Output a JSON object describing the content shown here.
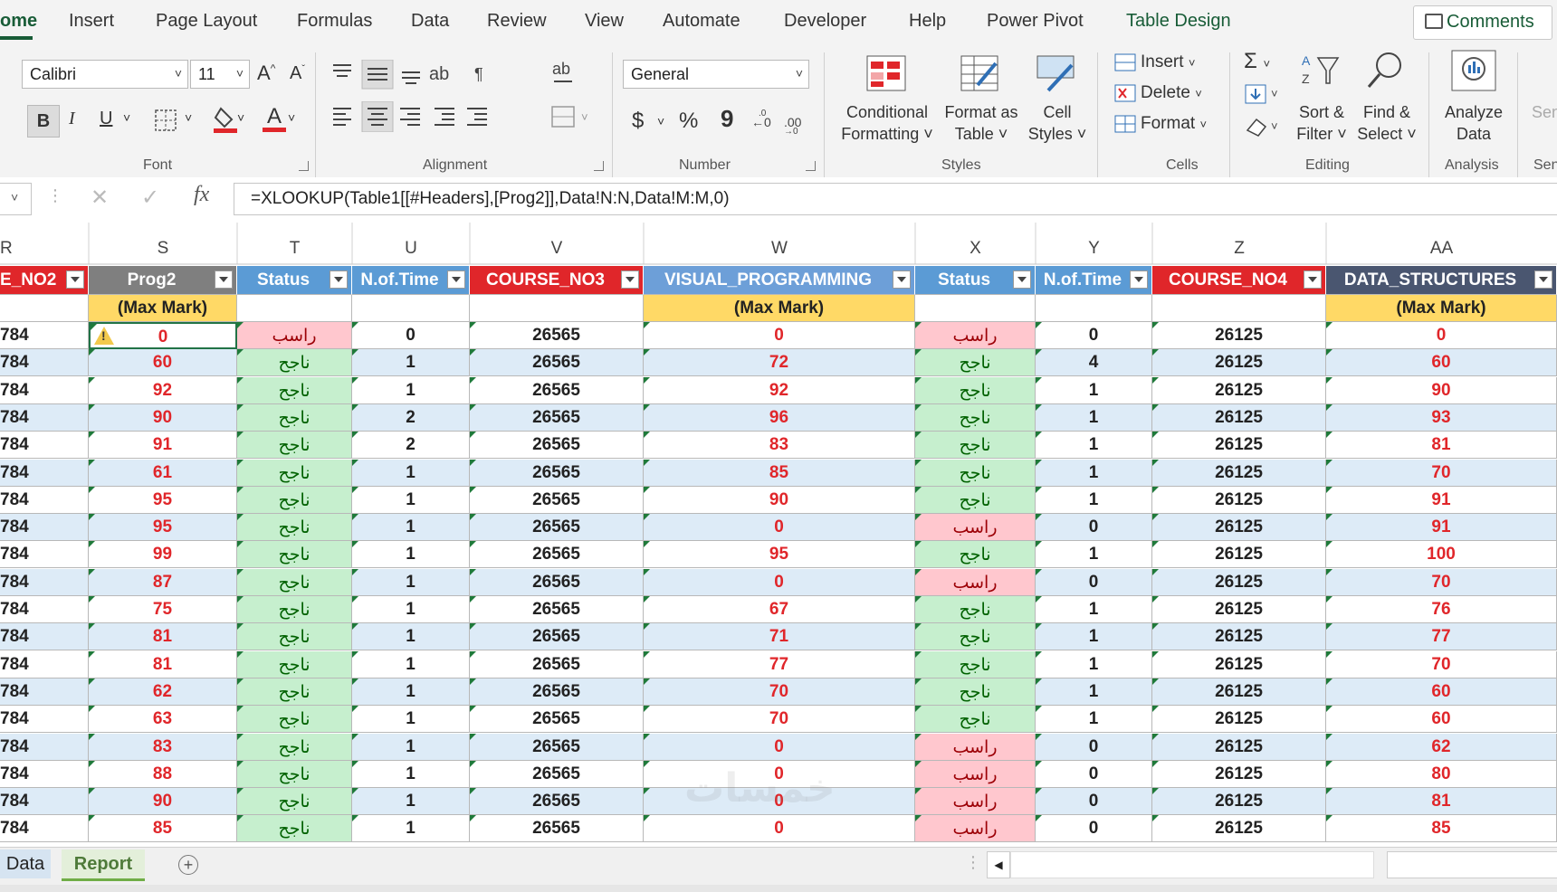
{
  "tabs": [
    "ome",
    "Insert",
    "Page Layout",
    "Formulas",
    "Data",
    "Review",
    "View",
    "Automate",
    "Developer",
    "Help",
    "Power Pivot",
    "Table Design"
  ],
  "comments_label": "Comments",
  "ribbon": {
    "font_name": "Calibri",
    "font_size": "11",
    "font_group": "Font",
    "alignment_group": "Alignment",
    "number_format": "General",
    "number_group": "Number",
    "styles_group": "Styles",
    "cells_group": "Cells",
    "editing_group": "Editing",
    "analysis_group": "Analysis",
    "sensitivity_partial": "Sen",
    "bold": "B",
    "italic": "I",
    "underline": "U",
    "currency": "$",
    "percent": "%",
    "comma": "9",
    "conditional_formatting": [
      "Conditional",
      "Formatting ˅"
    ],
    "format_as_table": [
      "Format as",
      "Table ˅"
    ],
    "cell_styles": [
      "Cell",
      "Styles ˅"
    ],
    "insert": "Insert",
    "delete": "Delete",
    "format": "Format",
    "sort_filter": [
      "Sort &",
      "Filter ˅"
    ],
    "find_select": [
      "Find &",
      "Select ˅"
    ],
    "analyze_data": [
      "Analyze",
      "Data"
    ]
  },
  "formula_bar": {
    "fx": "fx",
    "formula": "=XLOOKUP(Table1[[#Headers],[Prog2]],Data!N:N,Data!M:M,0)"
  },
  "columns": [
    "R",
    "S",
    "T",
    "U",
    "V",
    "W",
    "X",
    "Y",
    "Z",
    "AA"
  ],
  "headers": [
    "E_NO2",
    "Prog2",
    "Status",
    "N.of.Time",
    "COURSE_NO3",
    "VISUAL_PROGRAMMING",
    "Status",
    "N.of.Time",
    "COURSE_NO4",
    "DATA_STRUCTURES"
  ],
  "max_mark_label": "(Max Mark)",
  "rows": [
    [
      "784",
      "0",
      "راسب",
      "0",
      "26565",
      "0",
      "راسب",
      "0",
      "26125",
      "0"
    ],
    [
      "784",
      "60",
      "ناجح",
      "1",
      "26565",
      "72",
      "ناجح",
      "4",
      "26125",
      "60"
    ],
    [
      "784",
      "92",
      "ناجح",
      "1",
      "26565",
      "92",
      "ناجح",
      "1",
      "26125",
      "90"
    ],
    [
      "784",
      "90",
      "ناجح",
      "2",
      "26565",
      "96",
      "ناجح",
      "1",
      "26125",
      "93"
    ],
    [
      "784",
      "91",
      "ناجح",
      "2",
      "26565",
      "83",
      "ناجح",
      "1",
      "26125",
      "81"
    ],
    [
      "784",
      "61",
      "ناجح",
      "1",
      "26565",
      "85",
      "ناجح",
      "1",
      "26125",
      "70"
    ],
    [
      "784",
      "95",
      "ناجح",
      "1",
      "26565",
      "90",
      "ناجح",
      "1",
      "26125",
      "91"
    ],
    [
      "784",
      "95",
      "ناجح",
      "1",
      "26565",
      "0",
      "راسب",
      "0",
      "26125",
      "91"
    ],
    [
      "784",
      "99",
      "ناجح",
      "1",
      "26565",
      "95",
      "ناجح",
      "1",
      "26125",
      "100"
    ],
    [
      "784",
      "87",
      "ناجح",
      "1",
      "26565",
      "0",
      "راسب",
      "0",
      "26125",
      "70"
    ],
    [
      "784",
      "75",
      "ناجح",
      "1",
      "26565",
      "67",
      "ناجح",
      "1",
      "26125",
      "76"
    ],
    [
      "784",
      "81",
      "ناجح",
      "1",
      "26565",
      "71",
      "ناجح",
      "1",
      "26125",
      "77"
    ],
    [
      "784",
      "81",
      "ناجح",
      "1",
      "26565",
      "77",
      "ناجح",
      "1",
      "26125",
      "70"
    ],
    [
      "784",
      "62",
      "ناجح",
      "1",
      "26565",
      "70",
      "ناجح",
      "1",
      "26125",
      "60"
    ],
    [
      "784",
      "63",
      "ناجح",
      "1",
      "26565",
      "70",
      "ناجح",
      "1",
      "26125",
      "60"
    ],
    [
      "784",
      "83",
      "ناجح",
      "1",
      "26565",
      "0",
      "راسب",
      "0",
      "26125",
      "62"
    ],
    [
      "784",
      "88",
      "ناجح",
      "1",
      "26565",
      "0",
      "راسب",
      "0",
      "26125",
      "80"
    ],
    [
      "784",
      "90",
      "ناجح",
      "1",
      "26565",
      "0",
      "راسب",
      "0",
      "26125",
      "81"
    ],
    [
      "784",
      "85",
      "ناجح",
      "1",
      "26565",
      "0",
      "راسب",
      "0",
      "26125",
      "85"
    ]
  ],
  "sheets": [
    "Data",
    "Report"
  ],
  "watermark": "خمسات",
  "colors": {
    "accent": "#185c37",
    "header_gray": "#7f7f7f",
    "header_blue": "#5b9bd5",
    "header_red": "#e0262a",
    "header_visual_blue": "#6d9fd8",
    "header_navy": "#4a5670",
    "max_mark_fill": "#ffd966",
    "pass_fill": "#c6efce",
    "pass_text": "#006100",
    "fail_fill": "#ffc7ce",
    "fail_text": "#9c0006",
    "mark_red": "#e0262a"
  }
}
